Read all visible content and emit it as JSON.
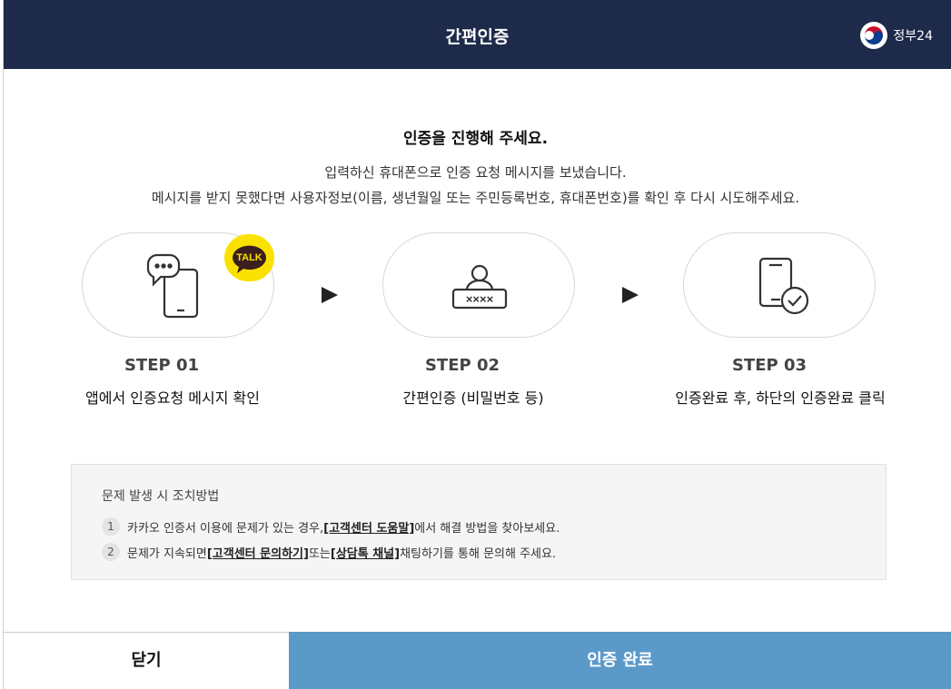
{
  "header": {
    "title": "간편인증",
    "brand": "정부24"
  },
  "main": {
    "heading": "인증을 진행해 주세요.",
    "desc_line1": "입력하신 휴대폰으로 인증 요청 메시지를 보냈습니다.",
    "desc_line2": "메시지를 받지 못했다면 사용자정보(이름, 생년월일 또는 주민등록번호, 휴대폰번호)를 확인 후 다시 시도해주세요."
  },
  "steps": [
    {
      "num": "STEP 01",
      "desc": "앱에서 인증요청 메시지 확인",
      "icon": "phone-chat-icon"
    },
    {
      "num": "STEP 02",
      "desc": "간편인증 (비밀번호 등)",
      "icon": "user-password-icon"
    },
    {
      "num": "STEP 03",
      "desc": "인증완료 후, 하단의 인증완료 클릭",
      "icon": "phone-check-icon"
    }
  ],
  "talk_badge": "TALK",
  "help": {
    "title": "문제 발생 시 조치방법",
    "items": [
      {
        "num": "1",
        "pre": "카카오 인증서 이용에 문제가 있는 경우, ",
        "link1": "[고객센터 도움말]",
        "mid": " 에서 해결 방법을 찾아보세요.",
        "link2": "",
        "post": ""
      },
      {
        "num": "2",
        "pre": "문제가 지속되면 ",
        "link1": "[고객센터 문의하기]",
        "mid": " 또는 ",
        "link2": "[상담톡 채널]",
        "post": " 채팅하기를 통해 문의해 주세요."
      }
    ]
  },
  "buttons": {
    "close": "닫기",
    "done": "인증 완료"
  },
  "colors": {
    "header_bg": "#1e2a4a",
    "done_bg": "#5b99c9",
    "talk_yellow": "#fae100"
  }
}
